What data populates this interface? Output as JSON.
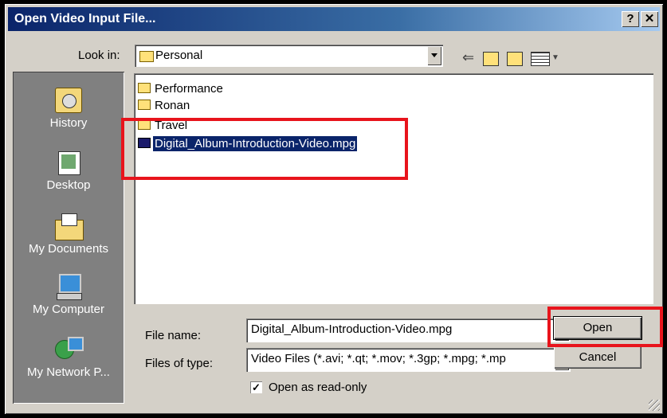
{
  "window": {
    "title": "Open Video Input File...",
    "help_label": "?",
    "close_label": "✕"
  },
  "lookin": {
    "label": "Look in:",
    "value": "Personal"
  },
  "toolbar": {
    "back_icon": "back-arrow-icon",
    "up_icon": "up-folder-icon",
    "newfolder_icon": "new-folder-icon",
    "view_icon": "view-menu-icon"
  },
  "places": [
    {
      "label": "History",
      "icon": "history-icon"
    },
    {
      "label": "Desktop",
      "icon": "desktop-icon"
    },
    {
      "label": "My Documents",
      "icon": "my-documents-icon"
    },
    {
      "label": "My Computer",
      "icon": "my-computer-icon"
    },
    {
      "label": "My Network P...",
      "icon": "my-network-places-icon"
    }
  ],
  "files": [
    {
      "name": "Performance",
      "type": "folder"
    },
    {
      "name": "Ronan",
      "type": "folder"
    },
    {
      "name": "Travel",
      "type": "folder"
    },
    {
      "name": "Digital_Album-Introduction-Video.mpg",
      "type": "video-file",
      "selected": true
    }
  ],
  "filename": {
    "label": "File name:",
    "value": "Digital_Album-Introduction-Video.mpg"
  },
  "filetype": {
    "label": "Files of type:",
    "value": "Video Files (*.avi; *.qt; *.mov; *.3gp; *.mpg; *.mp"
  },
  "readonly": {
    "label": "Open as read-only",
    "checked": true
  },
  "buttons": {
    "open": "Open",
    "cancel": "Cancel"
  },
  "colors": {
    "titlebar": "#0a246a",
    "highlight": "#e8141c",
    "selection": "#0a246a"
  }
}
